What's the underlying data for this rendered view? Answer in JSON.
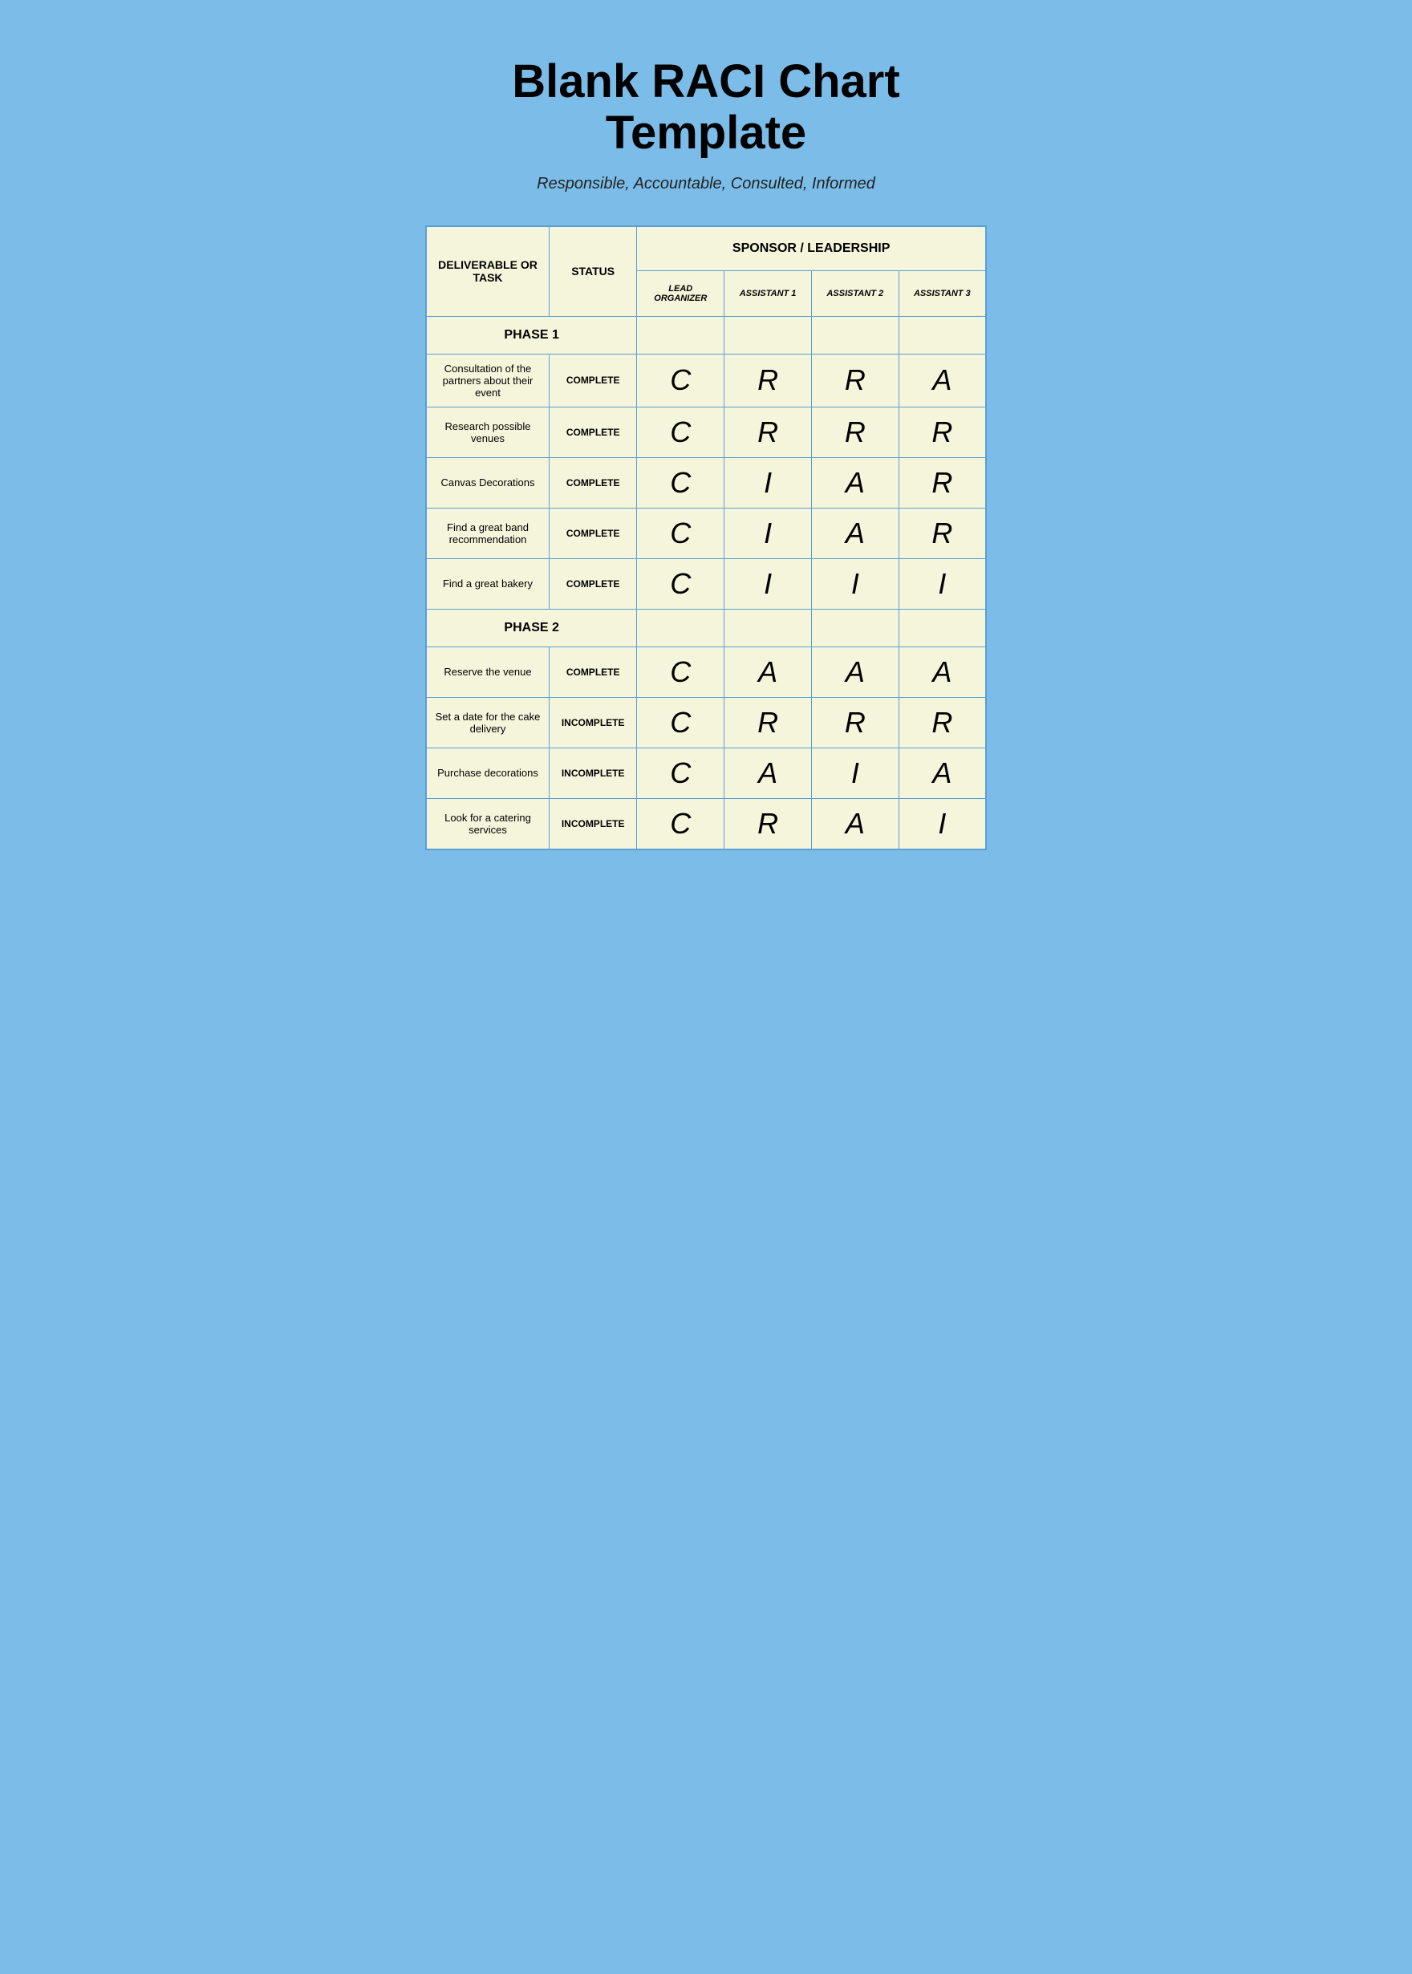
{
  "title": "Blank RACI Chart Template",
  "subtitle": "Responsible, Accountable, Consulted, Informed",
  "table": {
    "col1_header": "DELIVERABLE OR TASK",
    "col2_header": "STATUS",
    "sponsor_header": "SPONSOR / LEADERSHIP",
    "phase1_label": "PHASE 1",
    "phase2_label": "PHASE 2",
    "sub_headers": [
      "LEAD ORGANIZER",
      "ASSISTANT 1",
      "ASSISTANT 2",
      "ASSISTANT 3"
    ],
    "rows_phase1": [
      {
        "task": "Consultation of the partners about their event",
        "status": "COMPLETE",
        "lead": "C",
        "a1": "R",
        "a2": "R",
        "a3": "A"
      },
      {
        "task": "Research possible venues",
        "status": "COMPLETE",
        "lead": "C",
        "a1": "R",
        "a2": "R",
        "a3": "R"
      },
      {
        "task": "Canvas Decorations",
        "status": "COMPLETE",
        "lead": "C",
        "a1": "I",
        "a2": "A",
        "a3": "R"
      },
      {
        "task": "Find a great band recommendation",
        "status": "COMPLETE",
        "lead": "C",
        "a1": "I",
        "a2": "A",
        "a3": "R"
      },
      {
        "task": "Find a great bakery",
        "status": "COMPLETE",
        "lead": "C",
        "a1": "I",
        "a2": "I",
        "a3": "I"
      }
    ],
    "rows_phase2": [
      {
        "task": "Reserve the venue",
        "status": "COMPLETE",
        "lead": "C",
        "a1": "A",
        "a2": "A",
        "a3": "A"
      },
      {
        "task": "Set a date for the cake delivery",
        "status": "INCOMPLETE",
        "lead": "C",
        "a1": "R",
        "a2": "R",
        "a3": "R"
      },
      {
        "task": "Purchase decorations",
        "status": "INCOMPLETE",
        "lead": "C",
        "a1": "A",
        "a2": "I",
        "a3": "A"
      },
      {
        "task": "Look for a catering services",
        "status": "INCOMPLETE",
        "lead": "C",
        "a1": "R",
        "a2": "A",
        "a3": "I"
      }
    ]
  }
}
